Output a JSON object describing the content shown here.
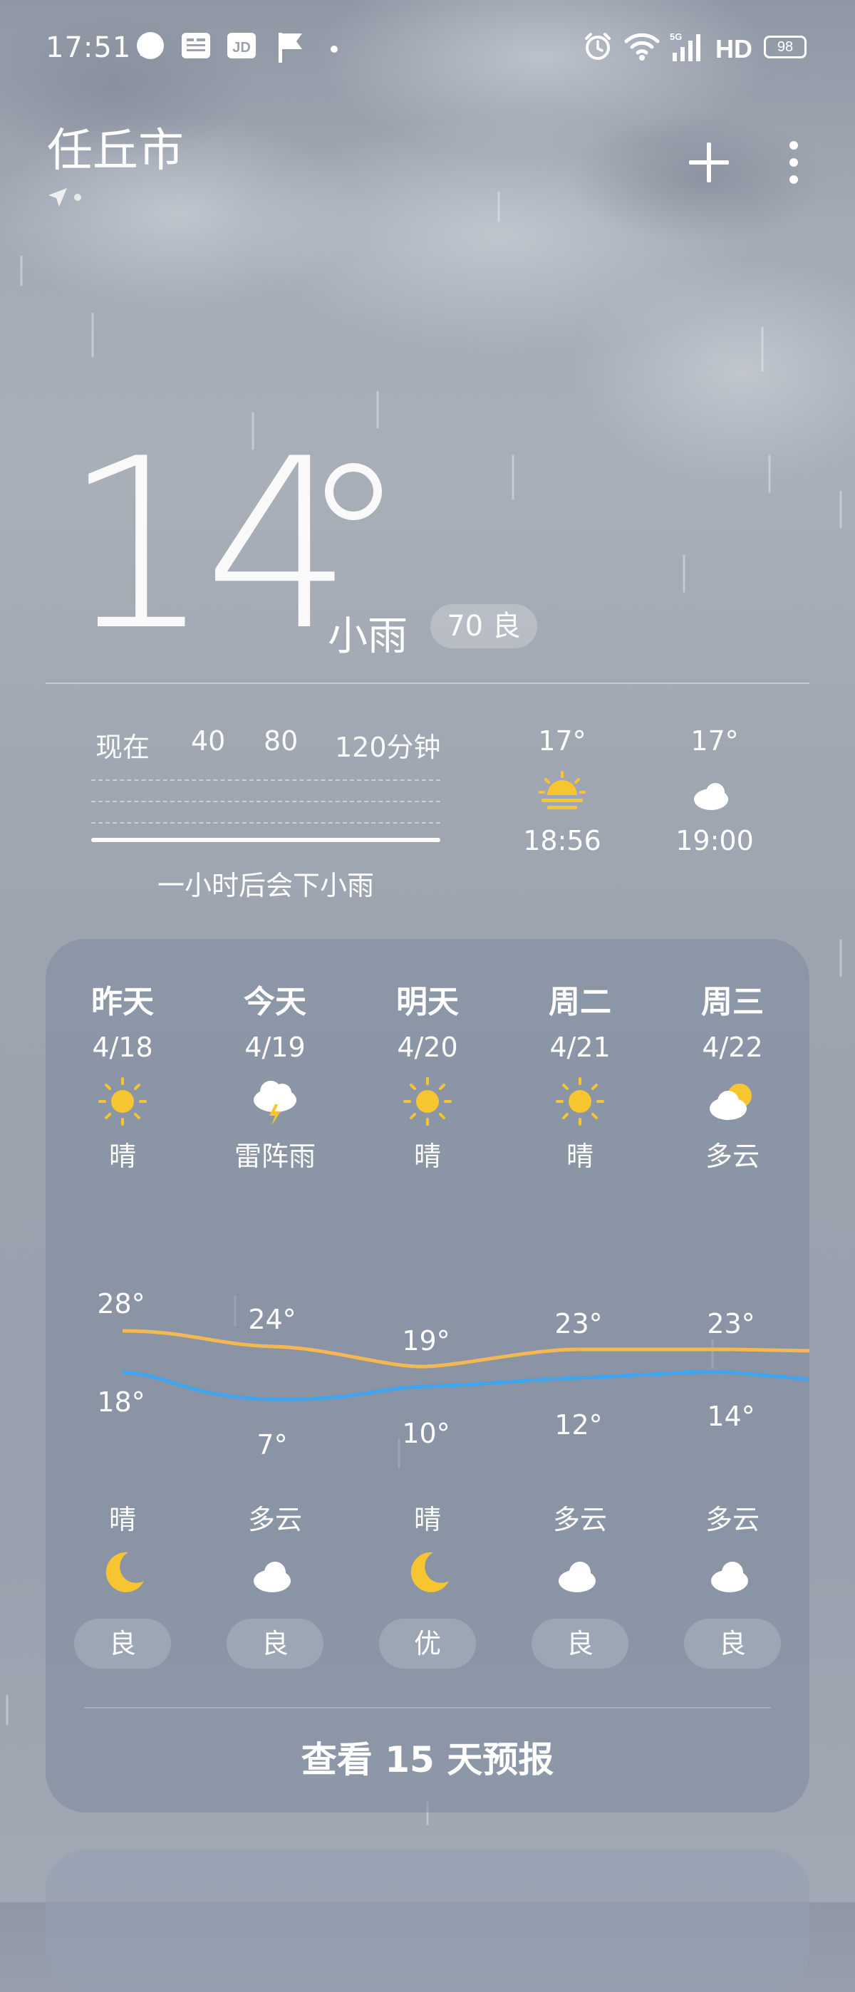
{
  "status_bar": {
    "time": "17:51",
    "icons_left": [
      "message-bubble-icon",
      "news-app-icon",
      "jd-app-icon",
      "flag-icon",
      "dot-icon"
    ],
    "jd_text": "JD",
    "icons_right": [
      "alarm-icon",
      "wifi-icon",
      "signal-5g-icon"
    ],
    "net_label": "HD",
    "signal_label": "5G",
    "battery": "98"
  },
  "header": {
    "city": "任丘市",
    "add_icon": "plus-icon",
    "menu_icon": "more-vertical-icon"
  },
  "current": {
    "temperature": "14",
    "condition": "小雨",
    "aqi": "70 良"
  },
  "rain_forecast": {
    "labels": [
      "现在",
      "40",
      "80",
      "120分钟"
    ],
    "description": "一小时后会下小雨"
  },
  "hourly": [
    {
      "temp": "17°",
      "icon": "sunset-icon",
      "time": "18:56"
    },
    {
      "temp": "17°",
      "icon": "cloudy-night-icon",
      "time": "19:00"
    }
  ],
  "daily": [
    {
      "day": "昨天",
      "date": "4/18",
      "icon": "sun-icon",
      "cond": "晴",
      "high": "28°",
      "low": "18°",
      "night_cond": "晴",
      "night_icon": "moon-icon",
      "aqi": "良"
    },
    {
      "day": "今天",
      "date": "4/19",
      "icon": "thunder-shower-icon",
      "cond": "雷阵雨",
      "high": "24°",
      "low": "7°",
      "night_cond": "多云",
      "night_icon": "cloudy-night-icon",
      "aqi": "良"
    },
    {
      "day": "明天",
      "date": "4/20",
      "icon": "sun-icon",
      "cond": "晴",
      "high": "19°",
      "low": "10°",
      "night_cond": "晴",
      "night_icon": "moon-icon",
      "aqi": "优"
    },
    {
      "day": "周二",
      "date": "4/21",
      "icon": "sun-icon",
      "cond": "晴",
      "high": "23°",
      "low": "12°",
      "night_cond": "多云",
      "night_icon": "cloudy-night-icon",
      "aqi": "良"
    },
    {
      "day": "周三",
      "date": "4/22",
      "icon": "partly-cloudy-icon",
      "cond": "多云",
      "high": "23°",
      "low": "14°",
      "night_cond": "多云",
      "night_icon": "cloudy-night-icon",
      "aqi": "良"
    }
  ],
  "more_forecast": "查看 15 天预报",
  "colors": {
    "high_line": "#f3b851",
    "low_line": "#3fa5ee",
    "sun": "#f7c530"
  }
}
